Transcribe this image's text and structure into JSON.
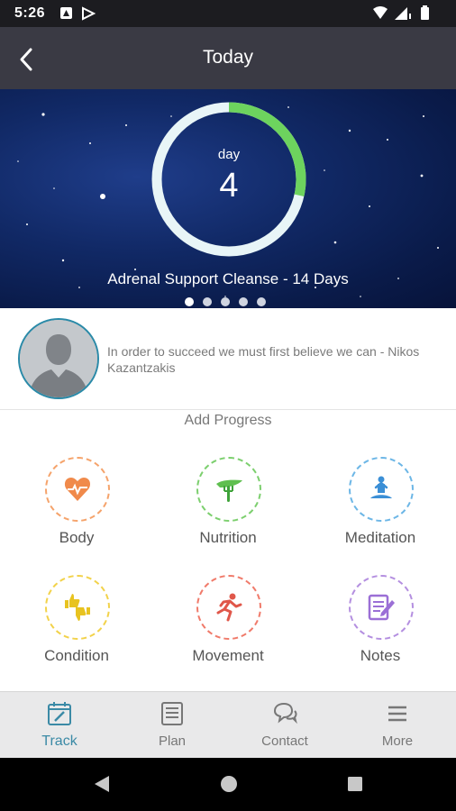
{
  "status_bar": {
    "time": "5:26"
  },
  "header": {
    "title": "Today",
    "back_icon": "chevron-left-icon"
  },
  "hero": {
    "day_label": "day",
    "day_number": "4",
    "program_name": "Adrenal Support Cleanse - 14 Days",
    "progress_fraction": 0.2857,
    "ring_colors": {
      "track": "#e8f5f7",
      "progress": "#6dd35e"
    },
    "page_count": 5,
    "active_page": 1
  },
  "quote": {
    "text": "In order to succeed we must first believe we can - Nikos Kazantzakis"
  },
  "add_progress": {
    "title": "Add Progress",
    "items": [
      {
        "label": "Body",
        "icon": "heart-pulse-icon",
        "color": "#f5a36b"
      },
      {
        "label": "Nutrition",
        "icon": "fork-greens-icon",
        "color": "#7ccf6e"
      },
      {
        "label": "Meditation",
        "icon": "meditation-figure-icon",
        "color": "#6cb6e6"
      },
      {
        "label": "Condition",
        "icon": "thumbs-up-down-icon",
        "color": "#f2d24a"
      },
      {
        "label": "Movement",
        "icon": "running-figure-icon",
        "color": "#f07a6a"
      },
      {
        "label": "Notes",
        "icon": "notepad-pencil-icon",
        "color": "#b48fe0"
      }
    ]
  },
  "tabs": [
    {
      "label": "Track",
      "icon": "calendar-pencil-icon",
      "active": true
    },
    {
      "label": "Plan",
      "icon": "list-document-icon",
      "active": false
    },
    {
      "label": "Contact",
      "icon": "chat-bubbles-icon",
      "active": false
    },
    {
      "label": "More",
      "icon": "menu-lines-icon",
      "active": false
    }
  ]
}
